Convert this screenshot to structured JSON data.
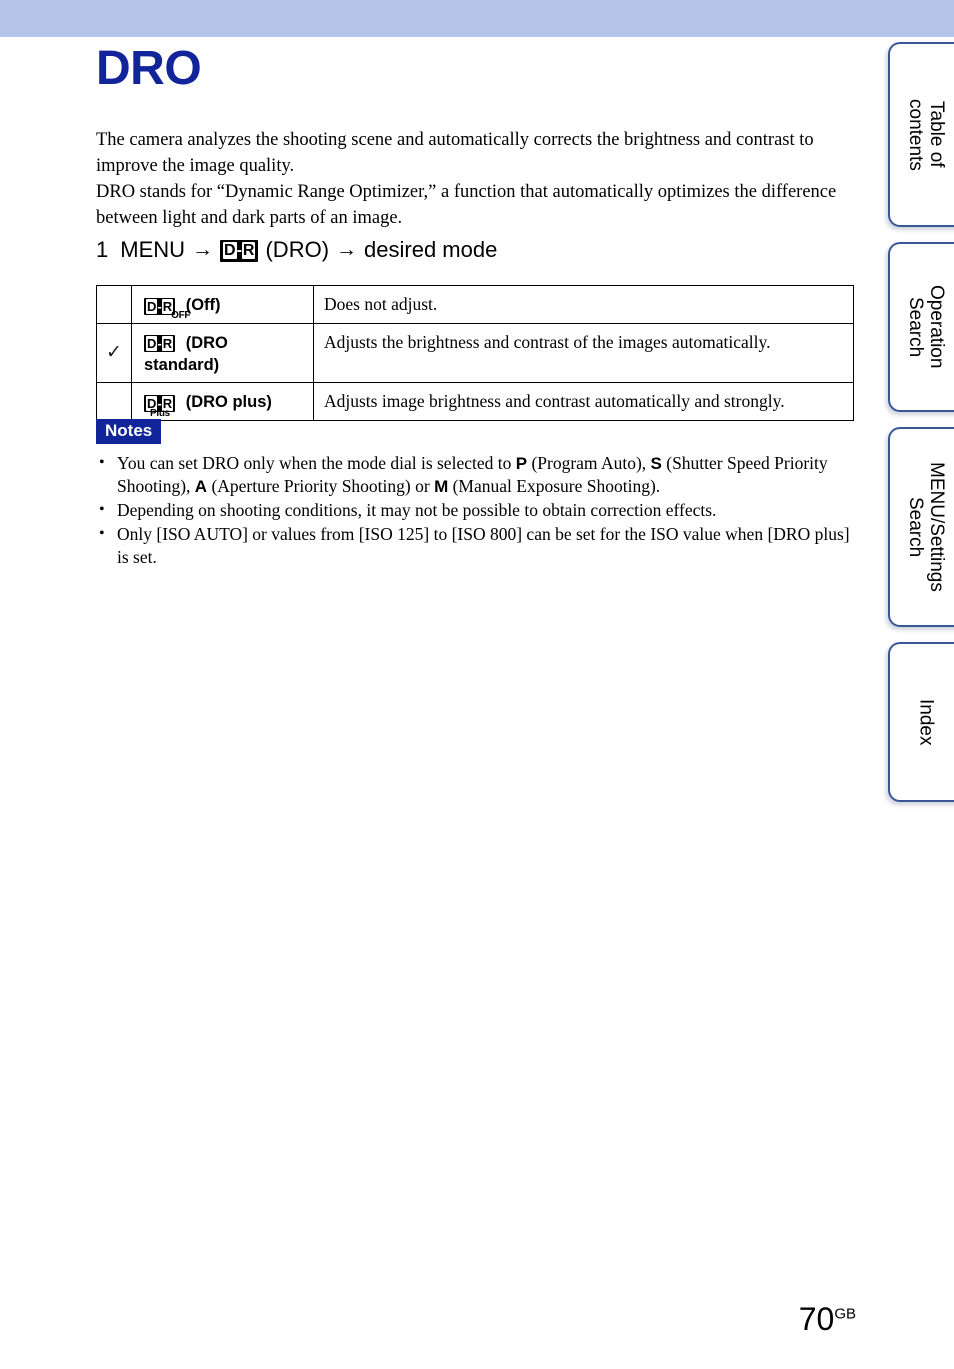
{
  "banner": {
    "color": "#b5c4e9"
  },
  "document": {
    "title": "DRO",
    "title_color": "#11249a",
    "intro_paragraph_1": "The camera analyzes the shooting scene and automatically corrects the brightness and contrast to improve the image quality.",
    "intro_paragraph_2": "DRO stands for “Dynamic Range Optimizer,” a function that automatically optimizes the difference between light and dark parts of an image."
  },
  "step": {
    "number": "1",
    "menu_label": "MENU",
    "arrow_1": "→",
    "icon_name": "dro-badge-icon",
    "icon_d": "D",
    "icon_sep": "-",
    "icon_r": "R",
    "icon_caption": "(DRO)",
    "arrow_2": "→",
    "target": "desired mode"
  },
  "table": {
    "rows": [
      {
        "selected": "",
        "icon_name": "dro-off-icon",
        "icon_sub": "OFF",
        "label": "(Off)",
        "description": "Does not adjust."
      },
      {
        "selected": "✓",
        "icon_name": "dro-standard-icon",
        "icon_sub": "",
        "label": "(DRO standard)",
        "description": "Adjusts the brightness and contrast of the images automatically."
      },
      {
        "selected": "",
        "icon_name": "dro-plus-icon",
        "icon_sub": "Plus",
        "label": "(DRO plus)",
        "description": "Adjusts image brightness and contrast automatically and strongly."
      }
    ]
  },
  "notes": {
    "heading": "Notes",
    "heading_bg": "#11249a",
    "items": [
      {
        "part_1": "You can set DRO only when the mode dial is selected to ",
        "letter_1": "P",
        "part_2": " (Program Auto), ",
        "letter_2": "S",
        "part_3": " (Shutter Speed Priority Shooting), ",
        "letter_3": "A",
        "part_4": " (Aperture Priority Shooting) or ",
        "letter_4": "M",
        "part_5": " (Manual Exposure Shooting)."
      },
      {
        "text": "Depending on shooting conditions, it may not be possible to obtain correction effects."
      },
      {
        "text": "Only [ISO AUTO] or values from [ISO 125] to [ISO 800] can be set for the ISO value when [DRO plus] is set."
      }
    ]
  },
  "page_number": {
    "value": "70",
    "suffix": "GB"
  },
  "tabs": [
    {
      "label": "Table of\ncontents"
    },
    {
      "label": "Operation\nSearch"
    },
    {
      "label": "MENU/Settings\nSearch"
    },
    {
      "label": "Index"
    }
  ]
}
